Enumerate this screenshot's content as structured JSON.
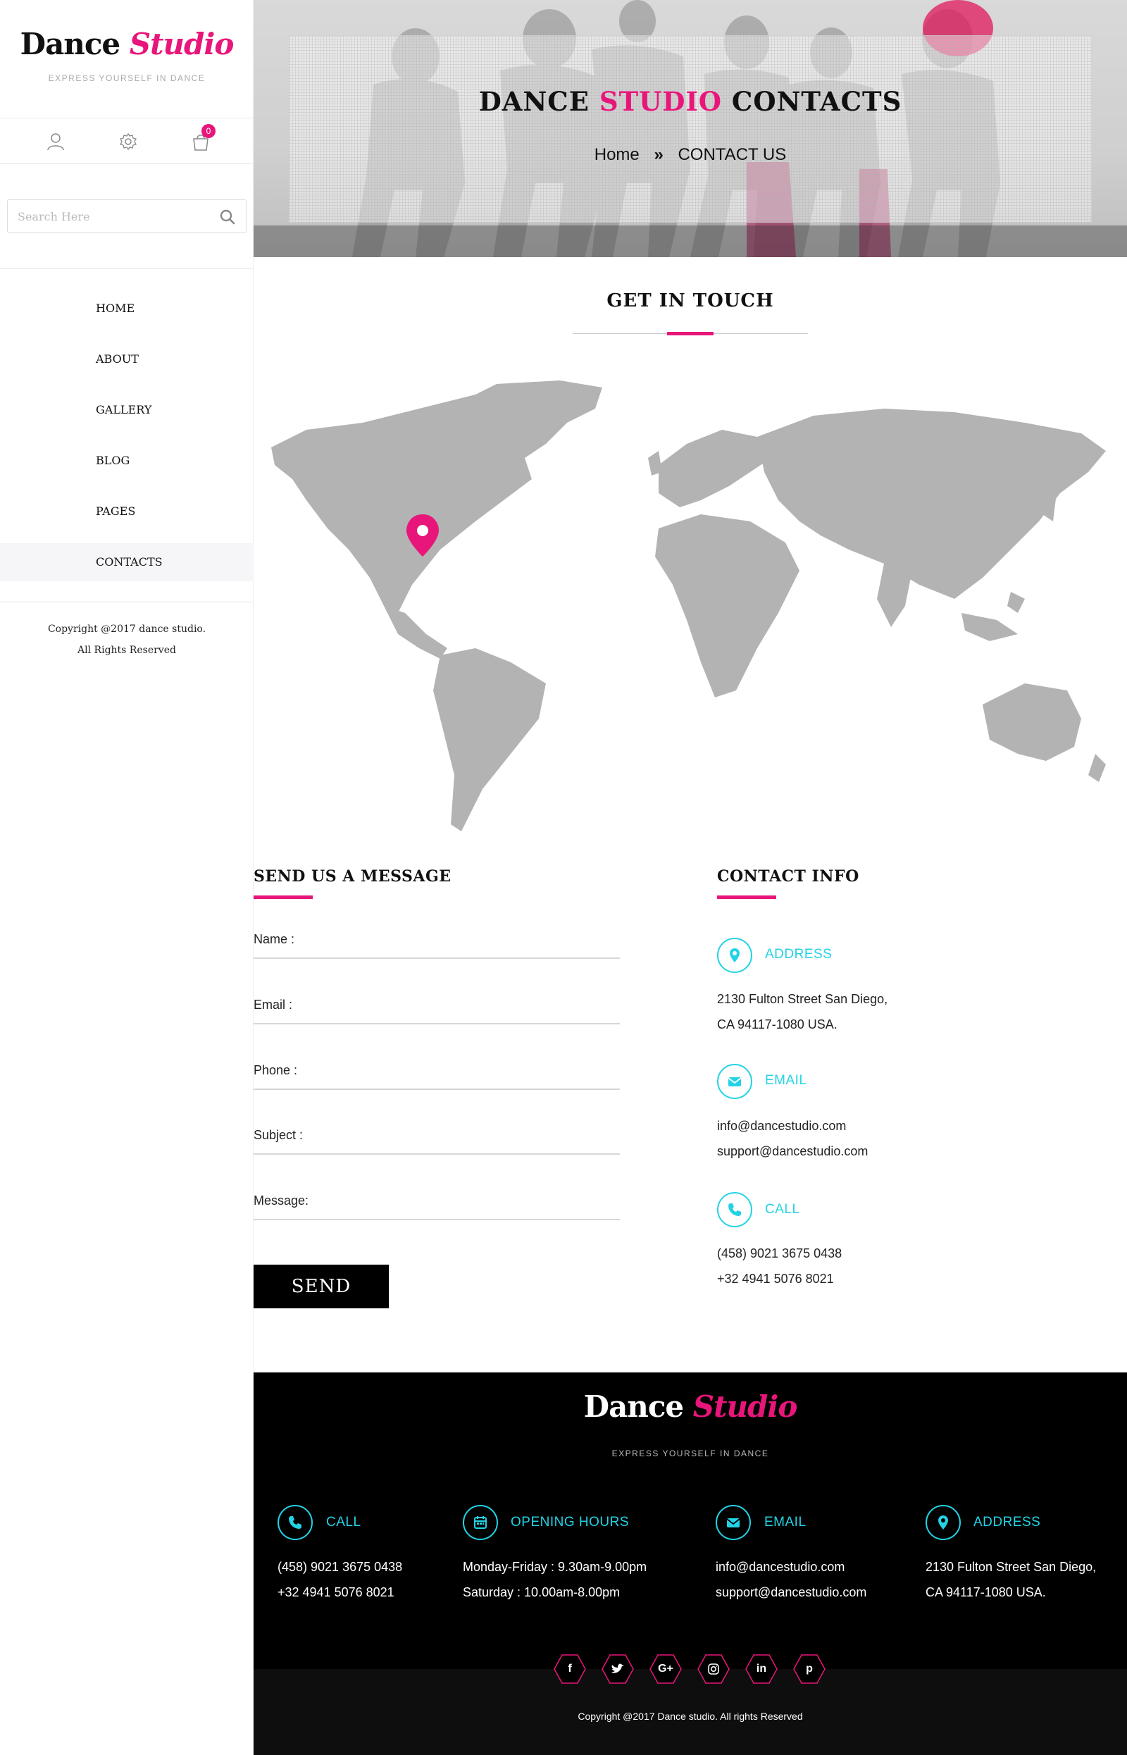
{
  "brand": {
    "word1": "Dance",
    "word2": "Studio",
    "tagline": "EXPRESS YOURSELF IN DANCE"
  },
  "sidebar": {
    "cart_count": "0",
    "search_placeholder": "Search Here",
    "nav": [
      {
        "label": "HOME"
      },
      {
        "label": "ABOUT"
      },
      {
        "label": "GALLERY"
      },
      {
        "label": "BLOG"
      },
      {
        "label": "PAGES"
      },
      {
        "label": "CONTACTS",
        "active": true
      }
    ],
    "copyright_line1": "Copyright @2017 dance studio.",
    "copyright_line2": "All Rights Reserved"
  },
  "hero": {
    "title_part1": "DANCE",
    "title_part2": "STUDIO",
    "title_part3": "CONTACTS",
    "breadcrumb_home": "Home",
    "breadcrumb_current": "CONTACT US"
  },
  "get_in_touch": {
    "title": "GET IN TOUCH"
  },
  "form": {
    "title": "SEND US A MESSAGE",
    "fields": [
      {
        "label": "Name    :",
        "value": ""
      },
      {
        "label": "Email    :",
        "value": ""
      },
      {
        "label": "Phone    :",
        "value": ""
      },
      {
        "label": "Subject  :",
        "value": ""
      },
      {
        "label": "Message:",
        "value": ""
      }
    ],
    "send_label": "SEND"
  },
  "contact_info": {
    "title": "CONTACT INFO",
    "address": {
      "label": "ADDRESS",
      "line1": "2130 Fulton Street San Diego,",
      "line2": "CA 94117-1080 USA."
    },
    "email": {
      "label": "EMAIL",
      "line1": "info@dancestudio.com",
      "line2": "support@dancestudio.com"
    },
    "call": {
      "label": "CALL",
      "line1": "(458) 9021 3675 0438",
      "line2": "+32 4941 5076 8021"
    }
  },
  "footer": {
    "call": {
      "label": "CALL",
      "line1": "(458) 9021 3675 0438",
      "line2": "+32 4941 5076 8021"
    },
    "hours": {
      "label": "OPENING HOURS",
      "line1": "Monday-Friday : 9.30am-9.00pm",
      "line2": "Saturday : 10.00am-8.00pm"
    },
    "email": {
      "label": "EMAIL",
      "line1": "info@dancestudio.com",
      "line2": "support@dancestudio.com"
    },
    "address": {
      "label": "ADDRESS",
      "line1": "2130 Fulton Street San Diego,",
      "line2": "CA 94117-1080 USA."
    },
    "social": [
      {
        "icon": "facebook-icon",
        "glyph": "f"
      },
      {
        "icon": "twitter-icon",
        "glyph": ""
      },
      {
        "icon": "google-plus-icon",
        "glyph": "G+"
      },
      {
        "icon": "instagram-icon",
        "glyph": ""
      },
      {
        "icon": "linkedin-icon",
        "glyph": "in"
      },
      {
        "icon": "pinterest-icon",
        "glyph": "p"
      }
    ],
    "copyright": "Copyright @2017 Dance studio. All rights Reserved"
  },
  "colors": {
    "accent": "#e8167a",
    "info": "#22d3e6",
    "footer_bg": "#000000"
  }
}
